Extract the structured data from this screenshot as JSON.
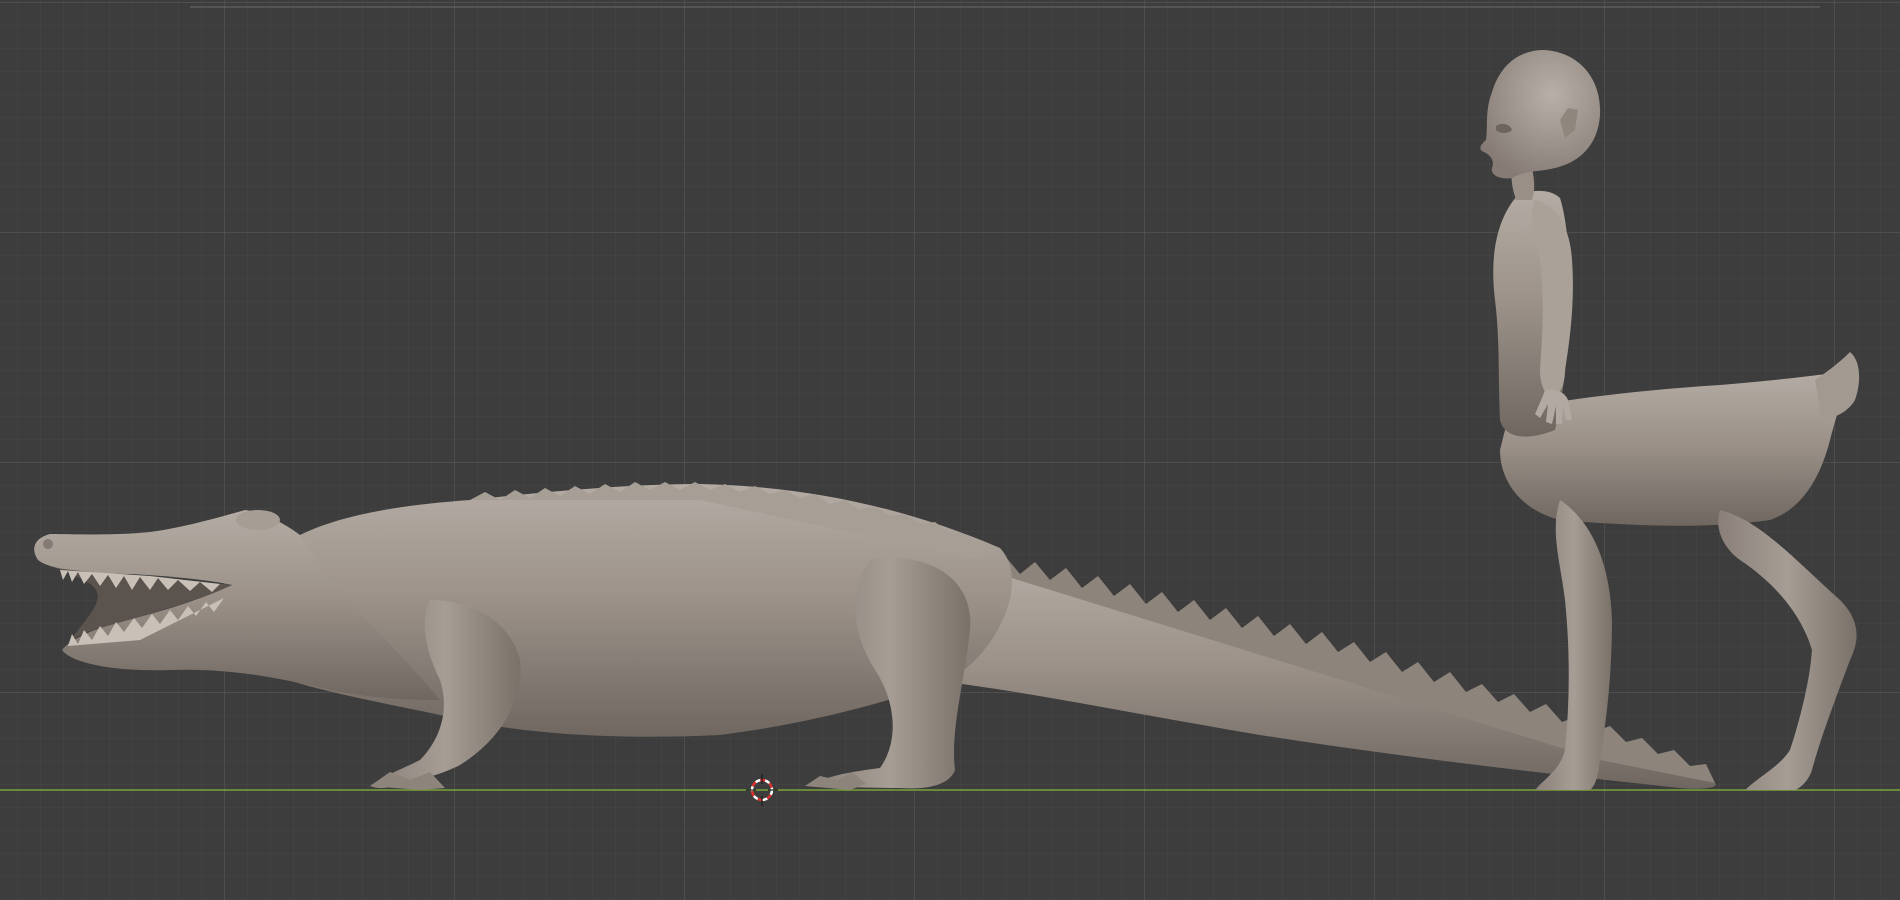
{
  "viewport": {
    "view": "orthographic-side",
    "background": "#3d3d3d",
    "grid_minor_color": "#474747",
    "grid_major_color": "#565656",
    "ground_axis_color": "#7aa33a",
    "model_color": "#9a9088"
  },
  "objects": [
    {
      "name": "alligator",
      "type": "sculpt-mesh"
    },
    {
      "name": "centaur-girl",
      "type": "sculpt-mesh"
    }
  ],
  "cursor": {
    "name": "3d-cursor",
    "colors": [
      "#e03030",
      "#ffffff"
    ]
  }
}
